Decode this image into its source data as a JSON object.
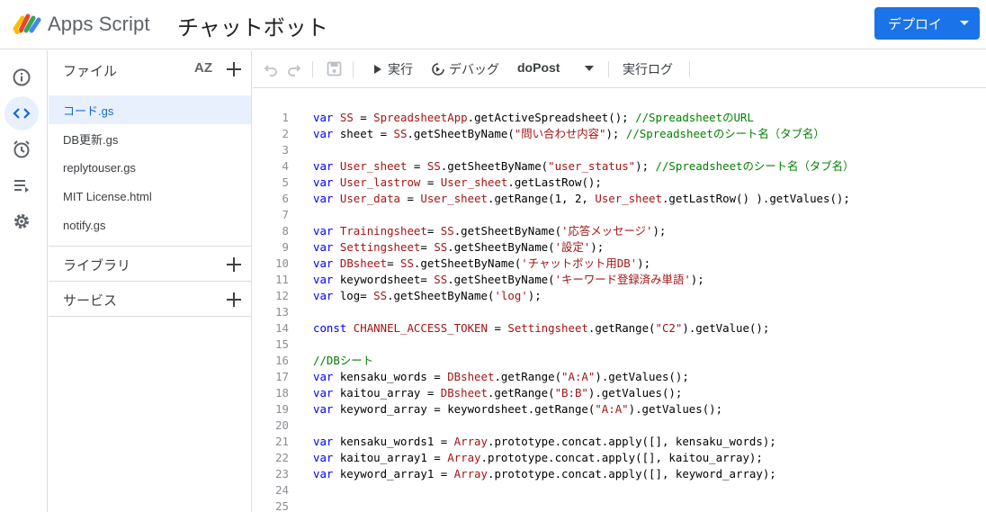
{
  "header": {
    "app_name": "Apps Script",
    "project_title": "チャットボット",
    "deploy_label": "デプロイ"
  },
  "files_panel": {
    "title": "ファイル",
    "sort_label": "AZ",
    "files": [
      "コード.gs",
      "DB更新.gs",
      "replytouser.gs",
      "MIT License.html",
      "notify.gs"
    ],
    "active_file": "コード.gs",
    "sections": [
      "ライブラリ",
      "サービス"
    ]
  },
  "toolbar": {
    "run_label": "実行",
    "debug_label": "デバッグ",
    "function_name": "doPost",
    "log_label": "実行ログ"
  },
  "editor": {
    "lines": [
      "var SS = SpreadsheetApp.getActiveSpreadsheet(); //SpreadsheetのURL",
      "var sheet = SS.getSheetByName(\"問い合わせ内容\"); //Spreadsheetのシート名（タブ名）",
      "",
      "var User_sheet = SS.getSheetByName(\"user_status\"); //Spreadsheetのシート名（タブ名）",
      "var User_lastrow = User_sheet.getLastRow();",
      "var User_data = User_sheet.getRange(1, 2, User_sheet.getLastRow() ).getValues();",
      "",
      "var Trainingsheet= SS.getSheetByName('応答メッセージ');",
      "var Settingsheet= SS.getSheetByName('設定');",
      "var DBsheet= SS.getSheetByName('チャットボット用DB');",
      "var keywordsheet= SS.getSheetByName('キーワード登録済み単語');",
      "var log= SS.getSheetByName('log');",
      "",
      "const CHANNEL_ACCESS_TOKEN = Settingsheet.getRange(\"C2\").getValue();",
      "",
      "//DBシート",
      "var kensaku_words = DBsheet.getRange(\"A:A\").getValues();",
      "var kaitou_array = DBsheet.getRange(\"B:B\").getValues();",
      "var keyword_array = keywordsheet.getRange(\"A:A\").getValues();",
      "",
      "var kensaku_words1 = Array.prototype.concat.apply([], kensaku_words);",
      "var kaitou_array1 = Array.prototype.concat.apply([], kaitou_array);",
      "var keyword_array1 = Array.prototype.concat.apply([], keyword_array);",
      "",
      ""
    ]
  },
  "icons": {
    "rail": [
      "info-icon",
      "code-icon",
      "alarm-icon",
      "executions-icon",
      "settings-icon"
    ]
  },
  "colors": {
    "accent": "#1a73e8",
    "active_bg": "#e8f0fe"
  }
}
